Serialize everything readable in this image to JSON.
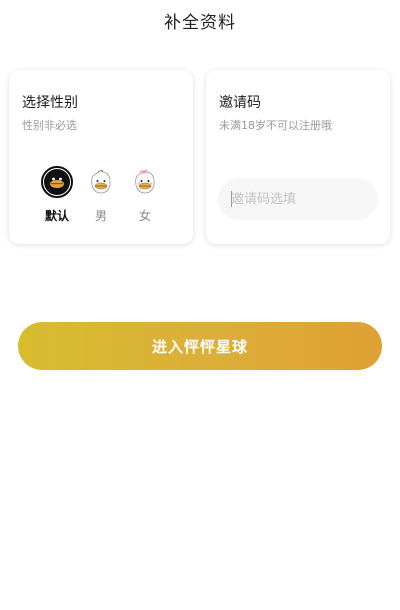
{
  "header": {
    "title": "补全资料"
  },
  "gender_card": {
    "title": "选择性别",
    "subtitle": "性别非必选",
    "options": [
      {
        "label": "默认",
        "icon": "default-duck-avatar-icon",
        "selected": true
      },
      {
        "label": "男",
        "icon": "male-duck-avatar-icon",
        "selected": false
      },
      {
        "label": "女",
        "icon": "female-duck-avatar-icon",
        "selected": false
      }
    ]
  },
  "invite_card": {
    "title": "邀请码",
    "subtitle": "未满18岁不可以注册哦",
    "input_placeholder": "邀请码选填",
    "input_value": ""
  },
  "enter_button": {
    "label": "进入怦怦星球"
  },
  "colors": {
    "button_gradient_start": "#d8bc2e",
    "button_gradient_end": "#dfa033",
    "subtitle_text": "#9a9a9a",
    "input_background": "#f6f6f6"
  }
}
